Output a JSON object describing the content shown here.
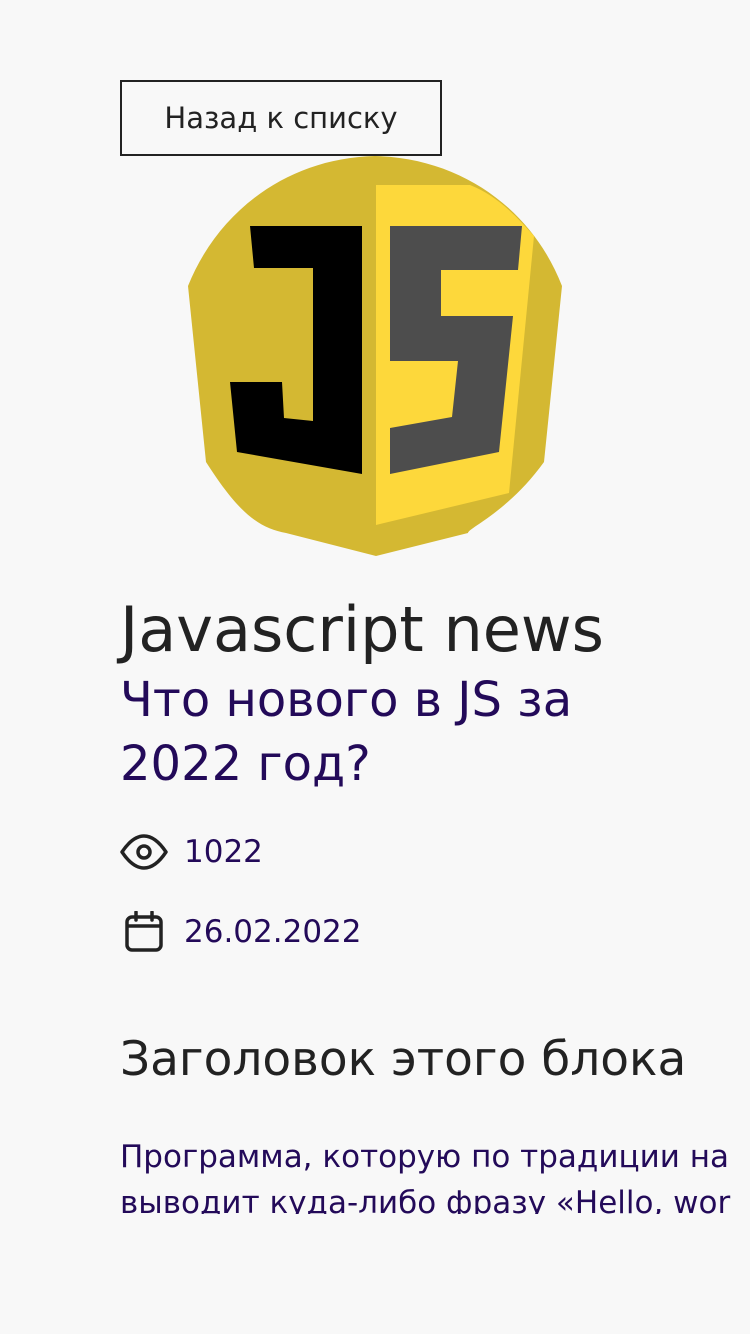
{
  "navigation": {
    "back_label": "Назад к списку"
  },
  "logo": {
    "text": "JS",
    "colors": {
      "shield_outer": "#d4b832",
      "shield_inner": "#fdd83b",
      "letter_j": "#000000",
      "letter_s": "#4d4d4d"
    }
  },
  "article": {
    "category": "Javascript news",
    "title": "Что нового в JS за 2022 год?",
    "views": "1022",
    "date": "26.02.2022",
    "icons": {
      "views": "eye-icon",
      "date": "calendar-icon"
    }
  },
  "section": {
    "heading": "Заголовок этого блока",
    "lines": [
      "Программа, которую по традиции на",
      "выводит куда-либо фразу «Hello, wor"
    ]
  },
  "colors": {
    "background": "#f8f8f8",
    "text_dark": "#222222",
    "accent": "#230a59"
  }
}
